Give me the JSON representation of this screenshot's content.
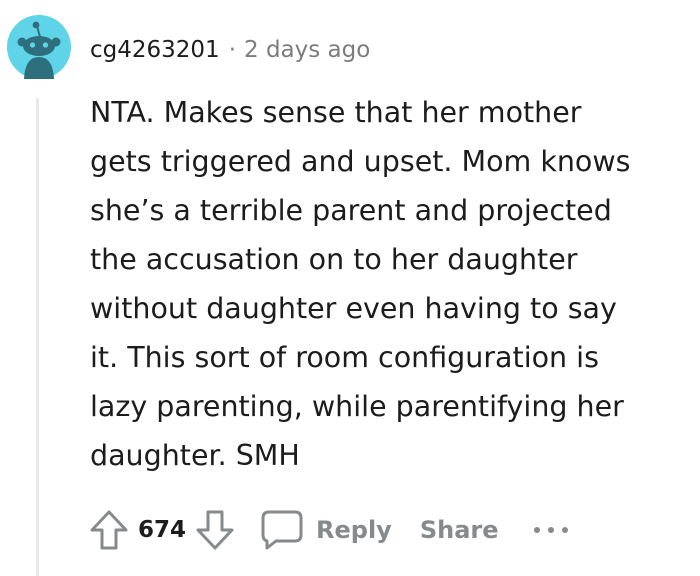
{
  "comment": {
    "username": "cg4263201",
    "separator": "·",
    "timestamp": "2 days ago",
    "body": "NTA. Makes sense that her mother\ngets triggered and upset. Mom knows\nshe’s a terrible parent and projected\nthe accusation on to her daughter\nwithout daughter even having to say\nit. This sort of room configuration is\nlazy parenting, while parentifying her\ndaughter. SMH",
    "score": "674"
  },
  "actions": {
    "reply_label": "Reply",
    "share_label": "Share"
  },
  "icons": {
    "avatar": "snoo-avatar-icon",
    "upvote": "upvote-arrow-icon",
    "downvote": "downvote-arrow-icon",
    "reply": "speech-bubble-icon",
    "more": "more-dots-icon"
  },
  "colors": {
    "avatar_background": "#5fd3e8",
    "snoo_body": "#2d6f7d",
    "muted_text": "#7c7c7c",
    "action_text": "#878a8c",
    "text": "#1c1c1c",
    "thread_line": "#e8e9ea"
  }
}
